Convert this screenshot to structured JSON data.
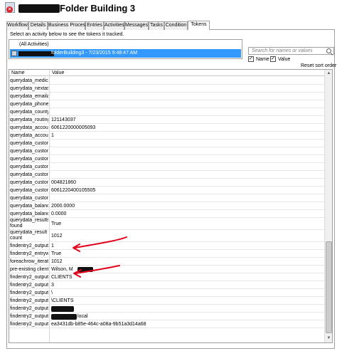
{
  "window": {
    "title": "Folder Building 3"
  },
  "tabs": [
    "Workflow",
    "Details",
    "Business Process",
    "Entries",
    "Activities",
    "Messages",
    "Tasks",
    "Condition",
    "Tokens"
  ],
  "active_tab": "Tokens",
  "instructions": "Select an activity below to see the tokens it tracked.",
  "activities": {
    "all": "(All Activities)",
    "selected_suffix": "folderBuilding3 - 7/23/2015 9:48:47 AM"
  },
  "search": {
    "placeholder": "Search for names or values"
  },
  "filters": {
    "name_label": "Name",
    "name_checked": true,
    "value_label": "Value",
    "value_checked": true
  },
  "reset_sort_label": "Reset sort order",
  "grid": {
    "columns": [
      "Name",
      "Value"
    ],
    "rows": [
      {
        "name": "querydata_medicare",
        "value": ""
      },
      {
        "name": "querydata_nextassess",
        "value": ""
      },
      {
        "name": "querydata_emailaddress",
        "value": ""
      },
      {
        "name": "querydata_phonecell",
        "value": ""
      },
      {
        "name": "querydata_county",
        "value": ""
      },
      {
        "name": "querydata_routing",
        "value": "121143037"
      },
      {
        "name": "querydata_account",
        "value": "6061220000005093"
      },
      {
        "name": "querydata_accounttype",
        "value": "1"
      },
      {
        "name": "querydata_customdata",
        "value": ""
      },
      {
        "name": "querydata_customdata",
        "value": ""
      },
      {
        "name": "querydata_customdata",
        "value": ""
      },
      {
        "name": "querydata_customdata",
        "value": ""
      },
      {
        "name": "querydata_customfield",
        "value": ""
      },
      {
        "name": "querydata_customfield",
        "value": "004821860"
      },
      {
        "name": "querydata_customfield",
        "value": "6061220400105505"
      },
      {
        "name": "querydata_customfield",
        "value": ""
      },
      {
        "name": "querydata_balancelevel",
        "value": "2000.0000"
      },
      {
        "name": "querydata_balancemin",
        "value": "0.0000"
      },
      {
        "name": "querydata_results found",
        "value": "True"
      },
      {
        "name": "querydata_result count",
        "value": "1012"
      },
      {
        "name": "findentry2_outputentry",
        "value": "1"
      },
      {
        "name": "findentry2_entrywasfound",
        "value": "True"
      },
      {
        "name": "foreachrow_iteration",
        "value": "1012"
      },
      {
        "name": "pre-existing client",
        "value": "Wilson, M"
      },
      {
        "name": "findentry2_outputentry",
        "value": "CLIENTS"
      },
      {
        "name": "findentry2_outputentry",
        "value": "3"
      },
      {
        "name": "findentry2_outputentry",
        "value": "\\"
      },
      {
        "name": "findentry2_outputentry",
        "value": "\\CLIENTS"
      },
      {
        "name": "findentry2_outputentry",
        "value": ""
      },
      {
        "name": "findentry2_outputentry",
        "value": "local"
      },
      {
        "name": "findentry2_outputentry",
        "value": "ea3431db-b85e-464c-a08a-9b51a3d14a68"
      }
    ]
  },
  "colors": {
    "selection": "#3399ff",
    "annotation_arrow": "#e0001b"
  }
}
